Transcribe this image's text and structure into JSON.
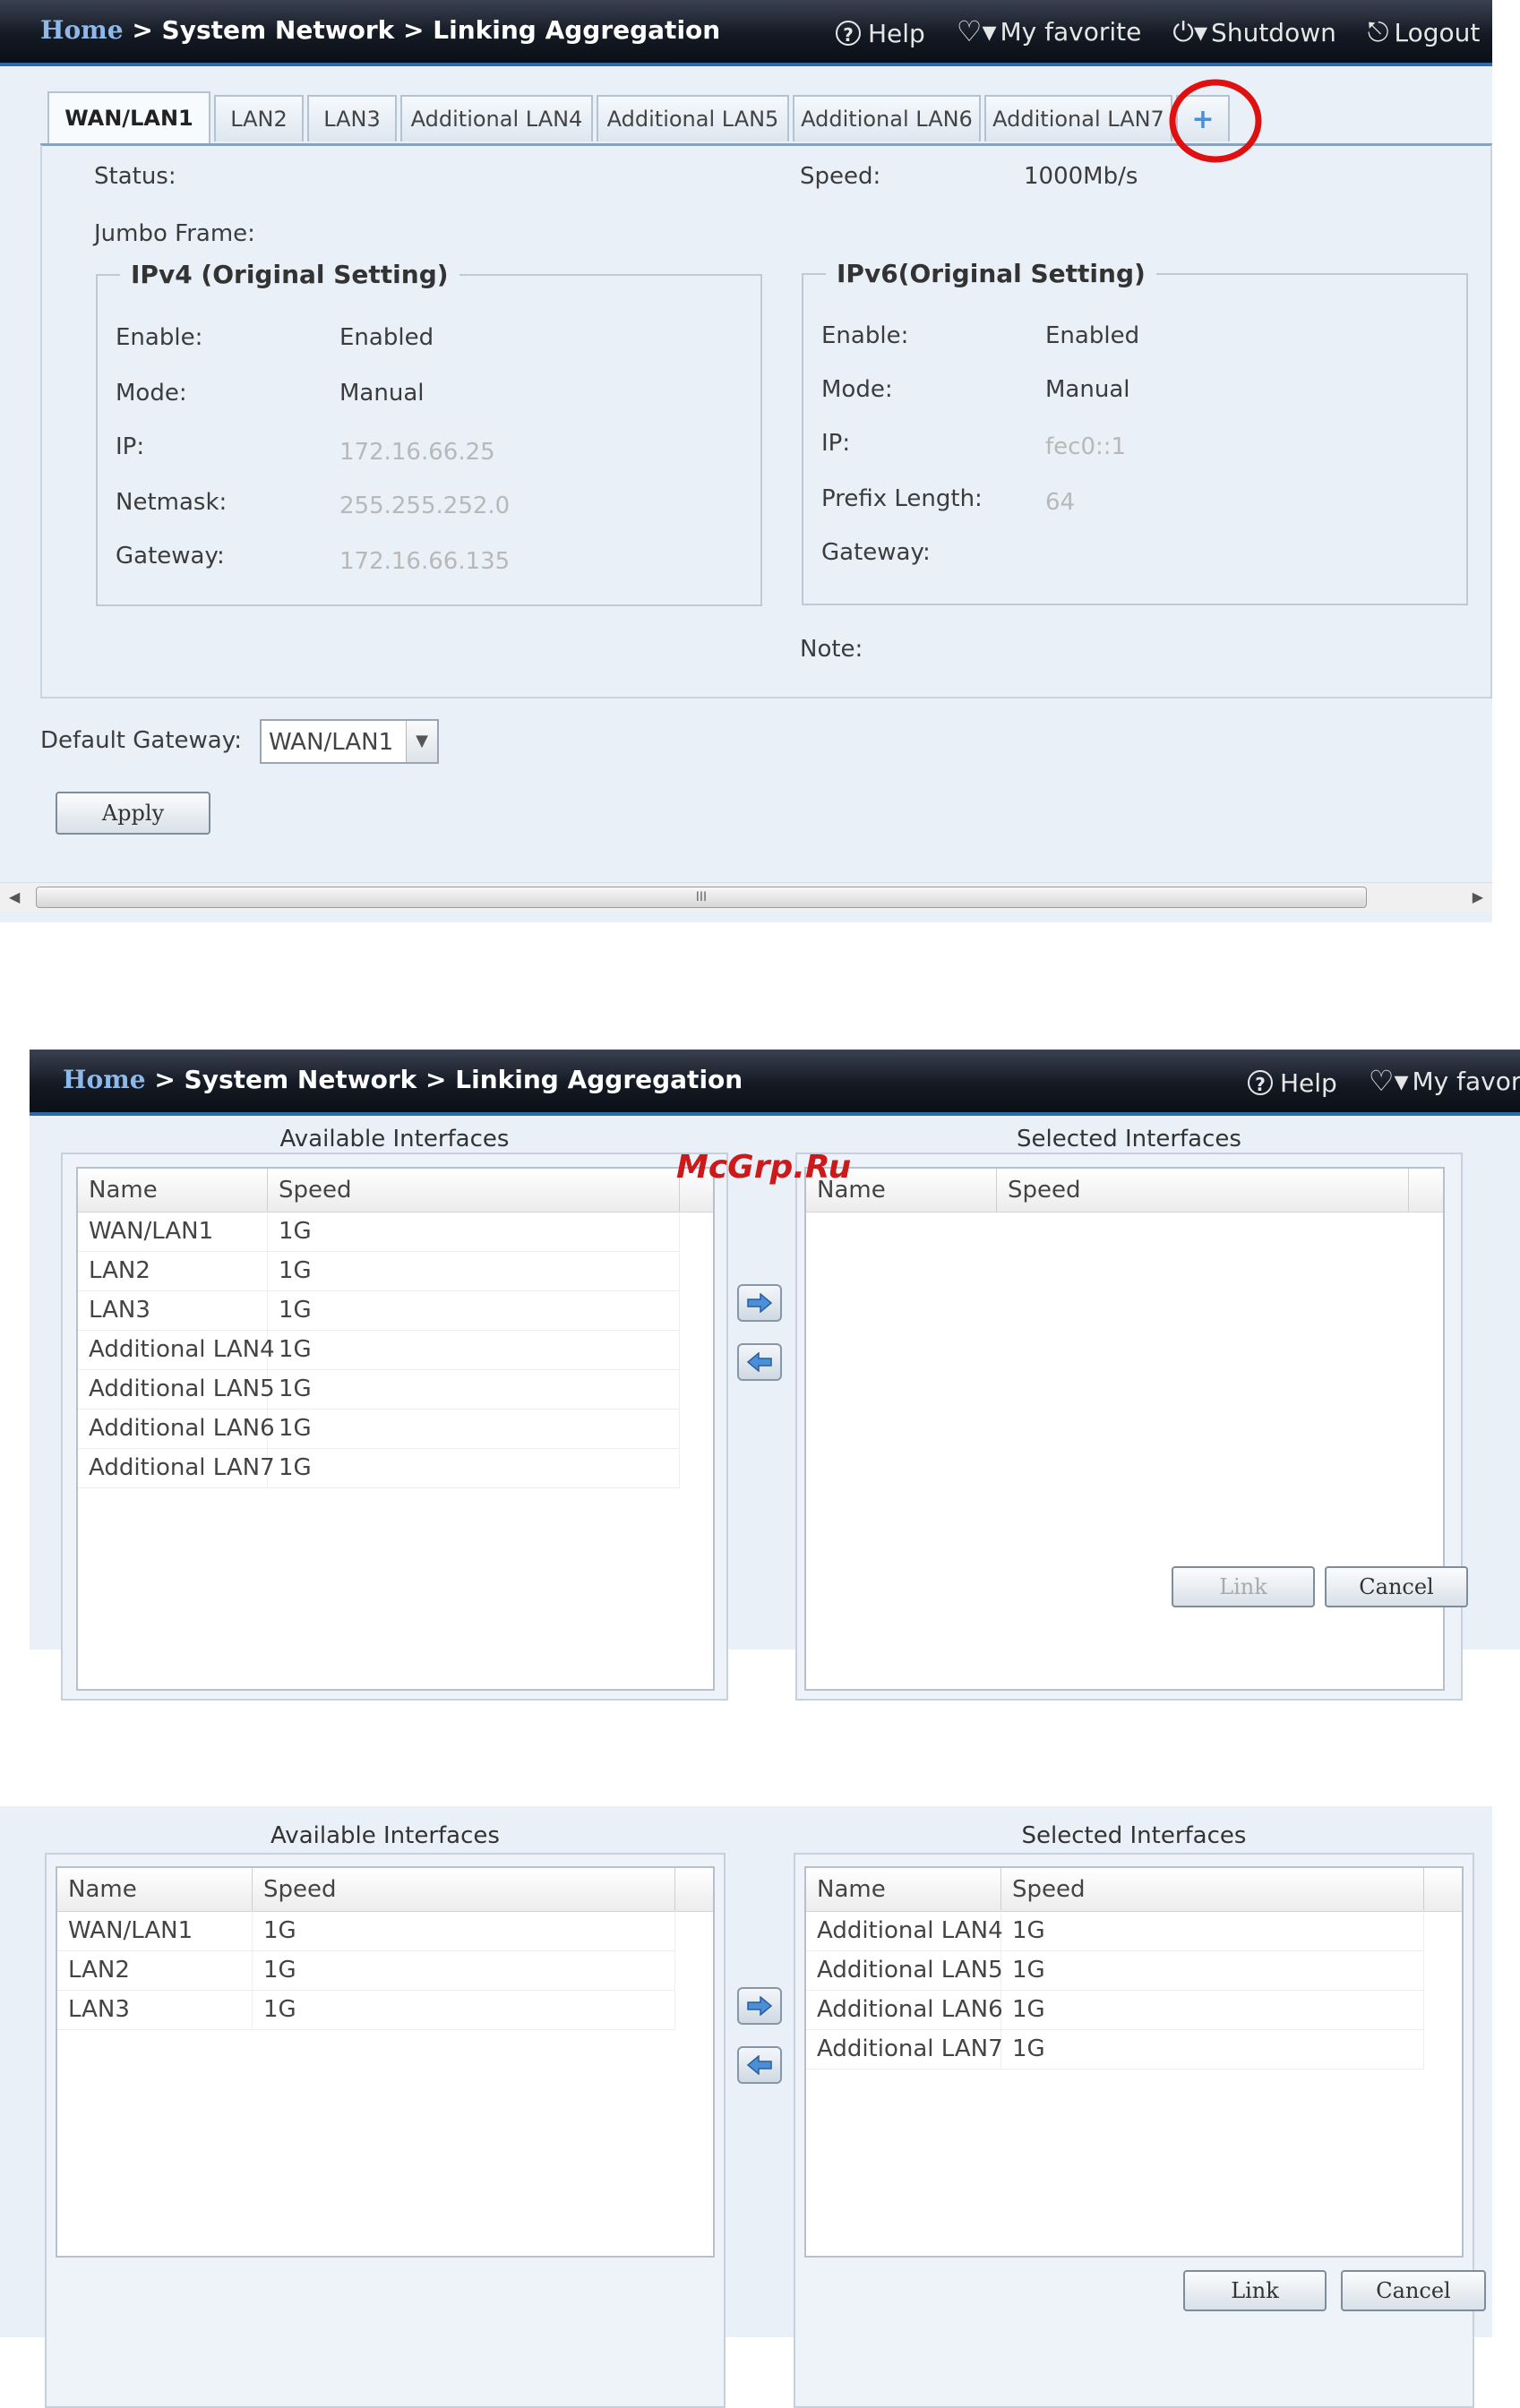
{
  "header": {
    "breadcrumb_home": "Home",
    "breadcrumb_sep": ">",
    "breadcrumb_section": "System Network",
    "breadcrumb_page": "Linking Aggregation",
    "help": "Help",
    "favorite": "My favorite",
    "shutdown": "Shutdown",
    "logout": "Logout"
  },
  "tabs": [
    "WAN/LAN1",
    "LAN2",
    "LAN3",
    "Additional LAN4",
    "Additional LAN5",
    "Additional LAN6",
    "Additional LAN7"
  ],
  "add_tab_symbol": "+",
  "status": {
    "status_label": "Status:",
    "speed_label": "Speed:",
    "speed_value": "1000Mb/s",
    "jumbo_label": "Jumbo Frame:",
    "note_label": "Note:"
  },
  "ipv4": {
    "legend": "IPv4 (Original Setting)",
    "enable_label": "Enable:",
    "enable_value": "Enabled",
    "mode_label": "Mode:",
    "mode_value": "Manual",
    "ip_label": "IP:",
    "ip_value": "172.16.66.25",
    "netmask_label": "Netmask:",
    "netmask_value": "255.255.252.0",
    "gateway_label": "Gateway:",
    "gateway_value": "172.16.66.135"
  },
  "ipv6": {
    "legend": "IPv6(Original Setting)",
    "enable_label": "Enable:",
    "enable_value": "Enabled",
    "mode_label": "Mode:",
    "mode_value": "Manual",
    "ip_label": "IP:",
    "ip_value": "fec0::1",
    "prefix_label": "Prefix Length:",
    "prefix_value": "64",
    "gateway_label": "Gateway:"
  },
  "default_gateway": {
    "label": "Default Gateway:",
    "value": "WAN/LAN1"
  },
  "apply_label": "Apply",
  "scroll_grip": "III",
  "link_dialog": {
    "available_title": "Available Interfaces",
    "selected_title": "Selected Interfaces",
    "col_name": "Name",
    "col_speed": "Speed",
    "link_label": "Link",
    "cancel_label": "Cancel"
  },
  "dialog1": {
    "available": [
      [
        "WAN/LAN1",
        "1G"
      ],
      [
        "LAN2",
        "1G"
      ],
      [
        "LAN3",
        "1G"
      ],
      [
        "Additional LAN4",
        "1G"
      ],
      [
        "Additional LAN5",
        "1G"
      ],
      [
        "Additional LAN6",
        "1G"
      ],
      [
        "Additional LAN7",
        "1G"
      ]
    ],
    "selected": []
  },
  "dialog2": {
    "available": [
      [
        "WAN/LAN1",
        "1G"
      ],
      [
        "LAN2",
        "1G"
      ],
      [
        "LAN3",
        "1G"
      ]
    ],
    "selected": [
      [
        "Additional LAN4",
        "1G"
      ],
      [
        "Additional LAN5",
        "1G"
      ],
      [
        "Additional LAN6",
        "1G"
      ],
      [
        "Additional LAN7",
        "1G"
      ]
    ]
  },
  "watermark": "McGrp.Ru",
  "colors": {
    "highlight_circle": "#e01010",
    "accent": "#2c6aa8",
    "panel_bg": "#e9f0f8"
  }
}
